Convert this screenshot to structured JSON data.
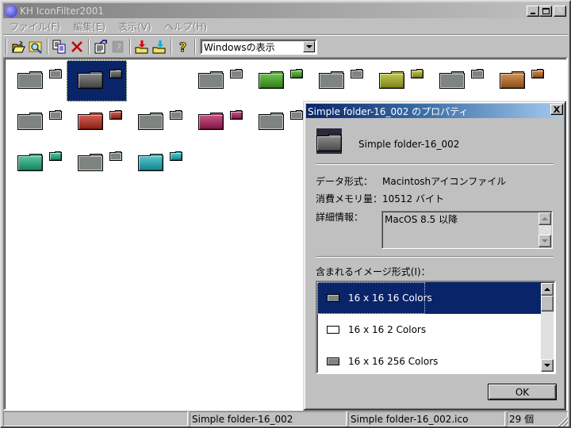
{
  "window": {
    "title": "KH IconFilter2001",
    "minimize_label": "_",
    "maximize_label": "□",
    "close_label": "X"
  },
  "menu": [
    {
      "label": "ファイル(F)"
    },
    {
      "label": "編集(E)"
    },
    {
      "label": "表示(V)"
    },
    {
      "label": "ヘルプ(H)"
    }
  ],
  "toolbar": {
    "buttons": [
      {
        "icon": "open-folder-icon"
      },
      {
        "icon": "find-icon"
      },
      {
        "icon": "copy-icon"
      },
      {
        "icon": "delete-icon"
      },
      {
        "icon": "properties-icon"
      },
      {
        "icon": "edit-icon",
        "disabled": true
      },
      {
        "icon": "import-icon"
      },
      {
        "icon": "export-icon"
      },
      {
        "icon": "help-icon"
      }
    ],
    "view_combo_value": "Windowsの表示"
  },
  "icons": [
    {
      "color": "grey",
      "selected": false
    },
    {
      "color": "#5e5e5e",
      "selected": true
    },
    {
      "color": "none"
    },
    {
      "color": "grey"
    },
    {
      "color": "#4a9a30"
    },
    {
      "color": "grey"
    },
    {
      "color": "#9aa030"
    },
    {
      "color": "grey"
    },
    {
      "color": "#a86a30"
    },
    {
      "color": "grey"
    },
    {
      "color": "#a83a30"
    },
    {
      "color": "grey"
    },
    {
      "color": "#a03060"
    },
    {
      "color": "grey"
    },
    {
      "color": "#3a3aa0"
    },
    {
      "color": "grey"
    },
    {
      "color": "#30a0a8"
    },
    {
      "color": "grey"
    },
    {
      "color": "#30a078"
    },
    {
      "color": "grey"
    },
    {
      "color": "#30a0a8"
    }
  ],
  "dialog": {
    "title": "Simple folder-16_002 のプロパティ",
    "close_label": "X",
    "icon_name": "Simple folder-16_002",
    "data_format_label": "データ形式：",
    "data_format_value": "Macintoshアイコンファイル",
    "memory_label": "消費メモリ量：",
    "memory_value": "10512 バイト",
    "detail_label": "詳細情報：",
    "detail_value": "MacOS 8.5 以降",
    "formats_label": "含まれるイメージ形式(I)：",
    "formats": [
      {
        "label": "16 x 16 16 Colors",
        "selected": true,
        "icon": "filled"
      },
      {
        "label": "16 x 16 2 Colors",
        "selected": false,
        "icon": "empty"
      },
      {
        "label": "16 x 16 256 Colors",
        "selected": false,
        "icon": "filled"
      }
    ],
    "ok_label": "OK"
  },
  "status": {
    "pane1": "",
    "pane2": "Simple folder-16_002",
    "pane3": "Simple folder-16_002.ico",
    "pane4": "29 個"
  }
}
